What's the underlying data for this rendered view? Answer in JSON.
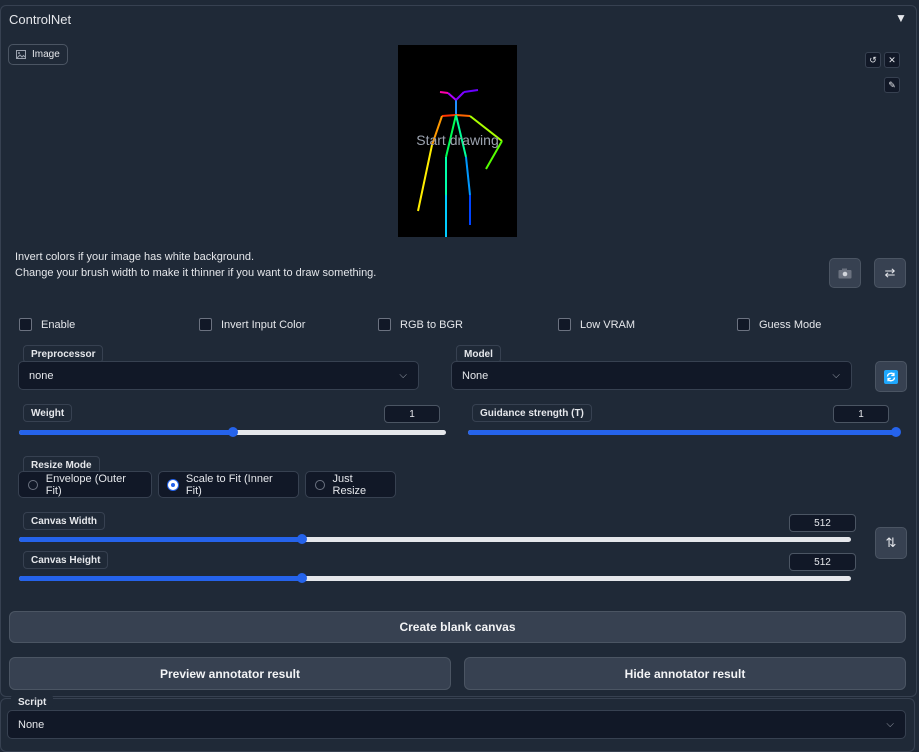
{
  "panel": {
    "title": "ControlNet",
    "collapse_icon": "triangle-down-icon"
  },
  "image_input": {
    "chip_label": "Image",
    "overlay_text": "Start drawing",
    "notes": [
      "Invert colors if your image has white background.",
      "Change your brush width to make it thinner if you want to draw something."
    ]
  },
  "checkboxes": [
    {
      "label": "Enable",
      "checked": false
    },
    {
      "label": "Invert Input Color",
      "checked": false
    },
    {
      "label": "RGB to BGR",
      "checked": false
    },
    {
      "label": "Low VRAM",
      "checked": false
    },
    {
      "label": "Guess Mode",
      "checked": false
    }
  ],
  "preprocessor": {
    "label": "Preprocessor",
    "value": "none"
  },
  "model": {
    "label": "Model",
    "value": "None"
  },
  "weight": {
    "label": "Weight",
    "value": "1",
    "level": 0.5
  },
  "guidance": {
    "label": "Guidance strength (T)",
    "value": "1",
    "level": 1.0
  },
  "resize_mode": {
    "label": "Resize Mode",
    "options": [
      "Envelope (Outer Fit)",
      "Scale to Fit (Inner Fit)",
      "Just Resize"
    ],
    "selected": "Scale to Fit (Inner Fit)"
  },
  "canvas_width": {
    "label": "Canvas Width",
    "value": "512",
    "level": 0.34
  },
  "canvas_height": {
    "label": "Canvas Height",
    "value": "512",
    "level": 0.34
  },
  "buttons": {
    "create_canvas": "Create blank canvas",
    "preview": "Preview annotator result",
    "hide": "Hide annotator result"
  },
  "script": {
    "label": "Script",
    "value": "None"
  },
  "colors": {
    "accent": "#2563eb",
    "background": "#1f2937",
    "input_bg": "#111827"
  }
}
